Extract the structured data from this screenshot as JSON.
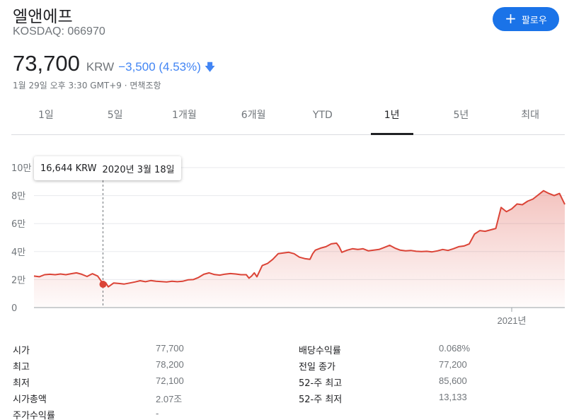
{
  "header": {
    "company_name": "엘앤에프",
    "ticker": "KOSDAQ: 066970",
    "follow_label": "팔로우",
    "follow_icon": "plus-icon"
  },
  "quote": {
    "price": "73,700",
    "currency": "KRW",
    "change": "−3,500 (4.53%)",
    "direction_icon": "arrow-down-icon",
    "timestamp": "1월 29일 오후 3:30 GMT+9 · ",
    "disclaimer": "면책조항"
  },
  "tabs": [
    {
      "label": "1일"
    },
    {
      "label": "5일"
    },
    {
      "label": "1개월"
    },
    {
      "label": "6개월"
    },
    {
      "label": "YTD"
    },
    {
      "label": "1년",
      "active": true
    },
    {
      "label": "5년"
    },
    {
      "label": "최대"
    }
  ],
  "tooltip": {
    "price": "16,644 KRW",
    "date": "2020년 3월 18일"
  },
  "colors": {
    "line": "#db4437",
    "accent": "#1a73e8",
    "change": "#4285f4"
  },
  "chart_data": {
    "type": "area",
    "y_ticks": [
      {
        "value": 100000,
        "label": "10만"
      },
      {
        "value": 80000,
        "label": "8만"
      },
      {
        "value": 60000,
        "label": "6만"
      },
      {
        "value": 40000,
        "label": "4만"
      },
      {
        "value": 20000,
        "label": "2만"
      },
      {
        "value": 0,
        "label": "0"
      }
    ],
    "x_ticks": [
      {
        "t": 0.9,
        "label": "2021년"
      }
    ],
    "ylim": [
      0,
      100000
    ],
    "grid": true,
    "hover_point": {
      "t": 0.13,
      "value": 16644
    },
    "series": [
      {
        "points": [
          [
            0.0,
            22500
          ],
          [
            0.01,
            22000
          ],
          [
            0.02,
            23500
          ],
          [
            0.03,
            23800
          ],
          [
            0.04,
            23500
          ],
          [
            0.05,
            24000
          ],
          [
            0.06,
            23500
          ],
          [
            0.07,
            24200
          ],
          [
            0.08,
            24800
          ],
          [
            0.09,
            23800
          ],
          [
            0.1,
            22200
          ],
          [
            0.11,
            24200
          ],
          [
            0.12,
            22500
          ],
          [
            0.125,
            19800
          ],
          [
            0.13,
            16644
          ],
          [
            0.135,
            17800
          ],
          [
            0.14,
            14800
          ],
          [
            0.15,
            17500
          ],
          [
            0.16,
            17200
          ],
          [
            0.17,
            16800
          ],
          [
            0.18,
            17500
          ],
          [
            0.19,
            18300
          ],
          [
            0.2,
            19200
          ],
          [
            0.21,
            18500
          ],
          [
            0.22,
            19300
          ],
          [
            0.23,
            18800
          ],
          [
            0.24,
            18600
          ],
          [
            0.25,
            18300
          ],
          [
            0.26,
            18800
          ],
          [
            0.27,
            18500
          ],
          [
            0.28,
            18800
          ],
          [
            0.29,
            19800
          ],
          [
            0.3,
            20000
          ],
          [
            0.31,
            21500
          ],
          [
            0.32,
            23800
          ],
          [
            0.33,
            24800
          ],
          [
            0.34,
            23600
          ],
          [
            0.35,
            23200
          ],
          [
            0.36,
            23900
          ],
          [
            0.37,
            24300
          ],
          [
            0.38,
            24000
          ],
          [
            0.39,
            23500
          ],
          [
            0.4,
            23500
          ],
          [
            0.405,
            21000
          ],
          [
            0.41,
            22500
          ],
          [
            0.415,
            24800
          ],
          [
            0.42,
            22000
          ],
          [
            0.43,
            30000
          ],
          [
            0.44,
            31500
          ],
          [
            0.45,
            34500
          ],
          [
            0.46,
            38500
          ],
          [
            0.47,
            39000
          ],
          [
            0.48,
            39500
          ],
          [
            0.49,
            38500
          ],
          [
            0.5,
            36000
          ],
          [
            0.51,
            35000
          ],
          [
            0.52,
            34500
          ],
          [
            0.525,
            38500
          ],
          [
            0.53,
            41000
          ],
          [
            0.54,
            42500
          ],
          [
            0.55,
            43500
          ],
          [
            0.56,
            45500
          ],
          [
            0.57,
            46000
          ],
          [
            0.575,
            43500
          ],
          [
            0.58,
            39500
          ],
          [
            0.59,
            41000
          ],
          [
            0.6,
            42000
          ],
          [
            0.61,
            41500
          ],
          [
            0.62,
            42000
          ],
          [
            0.63,
            40500
          ],
          [
            0.64,
            41000
          ],
          [
            0.65,
            41500
          ],
          [
            0.66,
            43000
          ],
          [
            0.67,
            44500
          ],
          [
            0.68,
            42500
          ],
          [
            0.69,
            41000
          ],
          [
            0.7,
            40500
          ],
          [
            0.71,
            40800
          ],
          [
            0.72,
            40200
          ],
          [
            0.73,
            40000
          ],
          [
            0.74,
            40200
          ],
          [
            0.75,
            39800
          ],
          [
            0.76,
            40500
          ],
          [
            0.77,
            41500
          ],
          [
            0.78,
            40800
          ],
          [
            0.79,
            42000
          ],
          [
            0.8,
            43500
          ],
          [
            0.81,
            44000
          ],
          [
            0.82,
            45500
          ],
          [
            0.83,
            52500
          ],
          [
            0.84,
            55000
          ],
          [
            0.85,
            54500
          ],
          [
            0.86,
            55500
          ],
          [
            0.87,
            56500
          ],
          [
            0.88,
            71500
          ],
          [
            0.89,
            68500
          ],
          [
            0.9,
            70500
          ],
          [
            0.91,
            74000
          ],
          [
            0.92,
            73500
          ],
          [
            0.93,
            76000
          ],
          [
            0.94,
            77500
          ],
          [
            0.95,
            80500
          ],
          [
            0.96,
            83500
          ],
          [
            0.97,
            81500
          ],
          [
            0.98,
            80000
          ],
          [
            0.99,
            81500
          ],
          [
            1.0,
            73700
          ]
        ]
      }
    ]
  },
  "stats": {
    "left": [
      {
        "label": "시가",
        "value": "77,700"
      },
      {
        "label": "최고",
        "value": "78,200"
      },
      {
        "label": "최저",
        "value": "72,100"
      },
      {
        "label": "시가총액",
        "value": "2.07조"
      },
      {
        "label": "주가수익률",
        "value": "-"
      }
    ],
    "right": [
      {
        "label": "배당수익률",
        "value": "0.068%"
      },
      {
        "label": "전일 종가",
        "value": "77,200"
      },
      {
        "label": "52-주 최고",
        "value": "85,600"
      },
      {
        "label": "52-주 최저",
        "value": "13,133"
      }
    ]
  }
}
